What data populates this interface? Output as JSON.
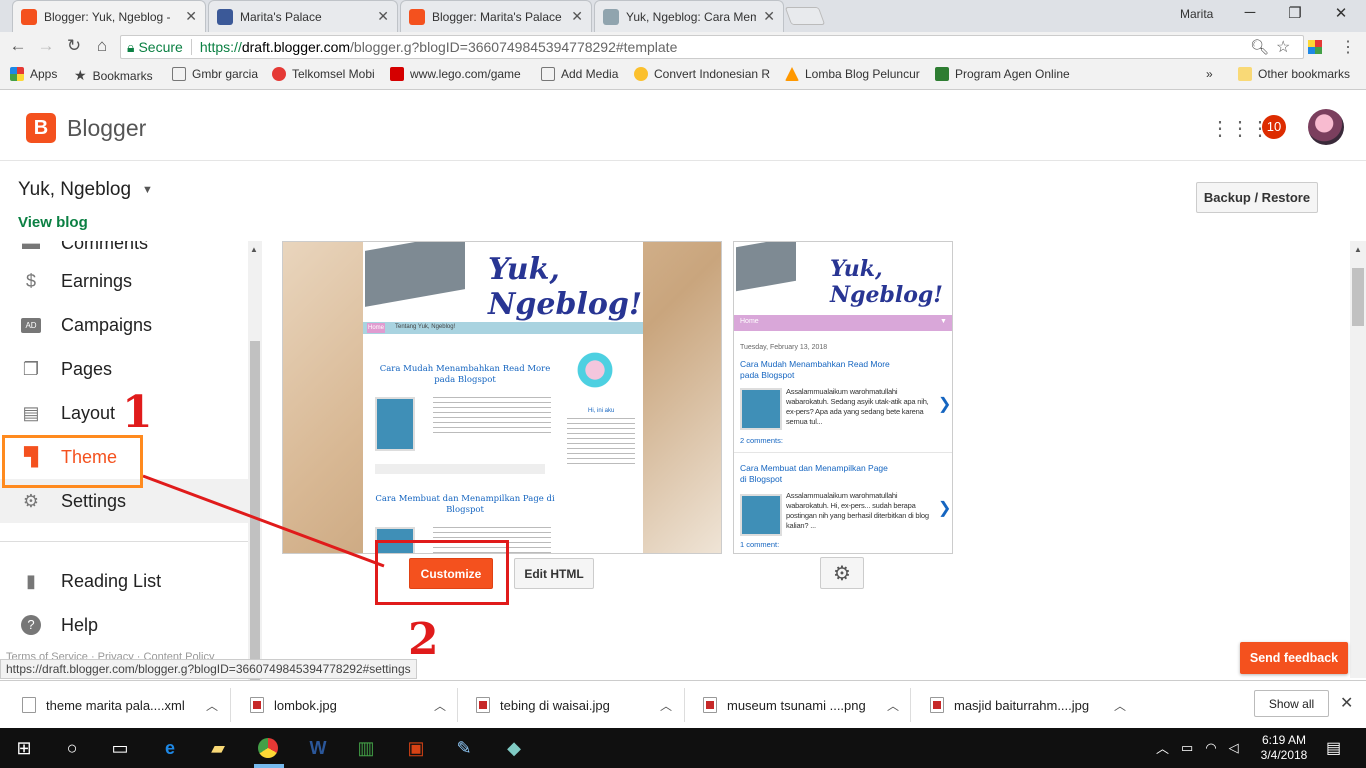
{
  "browser": {
    "tabs": [
      {
        "title": "Blogger: Yuk, Ngeblog -",
        "color": "#f4511e"
      },
      {
        "title": "Marita's Palace",
        "color": "#3b5998"
      },
      {
        "title": "Blogger: Marita's Palace",
        "color": "#f4511e"
      },
      {
        "title": "Yuk, Ngeblog: Cara Mem",
        "color": "#90a4ae"
      }
    ],
    "profile_name": "Marita",
    "secure_label": "Secure",
    "url_scheme": "https://",
    "url_host": "draft.blogger.com",
    "url_rest": "/blogger.g?blogID=3660749845394778292#template",
    "bookmarks": [
      "Apps",
      "Bookmarks",
      "Gmbr garcia",
      "Telkomsel Mobi",
      "www.lego.com/game",
      "Add Media",
      "Convert Indonesian R",
      "Lomba Blog Peluncur",
      "Program Agen Online"
    ],
    "bookmarks_overflow": "»",
    "other_bookmarks": "Other bookmarks",
    "status_url": "https://draft.blogger.com/blogger.g?blogID=3660749845394778292#settings"
  },
  "blogger": {
    "logo_letter": "B",
    "logo_text": "Blogger",
    "notification_count": "10",
    "blog_name": "Yuk, Ngeblog",
    "view_blog": "View blog",
    "backup_restore": "Backup / Restore",
    "nav": {
      "comments": "Comments",
      "earnings": "Earnings",
      "campaigns": "Campaigns",
      "pages": "Pages",
      "layout": "Layout",
      "theme": "Theme",
      "settings": "Settings",
      "reading_list": "Reading List",
      "help": "Help",
      "footer": "Terms of Service · Privacy · Content Policy"
    },
    "customize": "Customize",
    "edit_html": "Edit HTML",
    "send_feedback": "Send feedback"
  },
  "preview_desktop": {
    "blog_title": "Yuk, Ngeblog!",
    "nav_home": "Home",
    "nav_about": "Tentang Yuk, Ngeblog!",
    "post1_title": "Cara Mudah Menambahkan Read More pada Blogspot",
    "post2_title": "Cara Membuat dan Menampilkan Page di Blogspot",
    "sidebar_name": "Hi, ini aku"
  },
  "preview_mobile": {
    "blog_title": "Yuk, Ngeblog!",
    "nav_home": "Home",
    "date": "Tuesday, February 13, 2018",
    "post1_title": "Cara Mudah Menambahkan Read More pada Blogspot",
    "post1_snippet": "Assalammualaikum warohmatullahi wabarokatuh. Sedang asyik utak-atik apa nih, ex-pers? Apa ada yang sedang bete karena semua tul...",
    "post1_comments": "2 comments:",
    "post2_title": "Cara Membuat dan Menampilkan Page di Blogspot",
    "post2_snippet": "Assalammualaikum warohmatullahi wabarokatuh. Hi, ex-pers... sudah berapa postingan nih yang berhasil diterbitkan di blog kalian? ...",
    "post2_comments": "1 comment:"
  },
  "annotations": {
    "step1": "1",
    "step2": "2",
    "box_color": "#ff8a1e",
    "marker_color": "#e01b1b"
  },
  "downloads": {
    "items": [
      "theme marita pala....xml",
      "lombok.jpg",
      "tebing di waisai.jpg",
      "museum tsunami ....png",
      "masjid baiturrahm....jpg"
    ],
    "show_all": "Show all"
  },
  "taskbar": {
    "time": "6:19 AM",
    "date": "3/4/2018"
  },
  "colors": {
    "blogger_orange": "#f4511e",
    "secure_green": "#0b8043",
    "link_blue": "#1565c0"
  }
}
